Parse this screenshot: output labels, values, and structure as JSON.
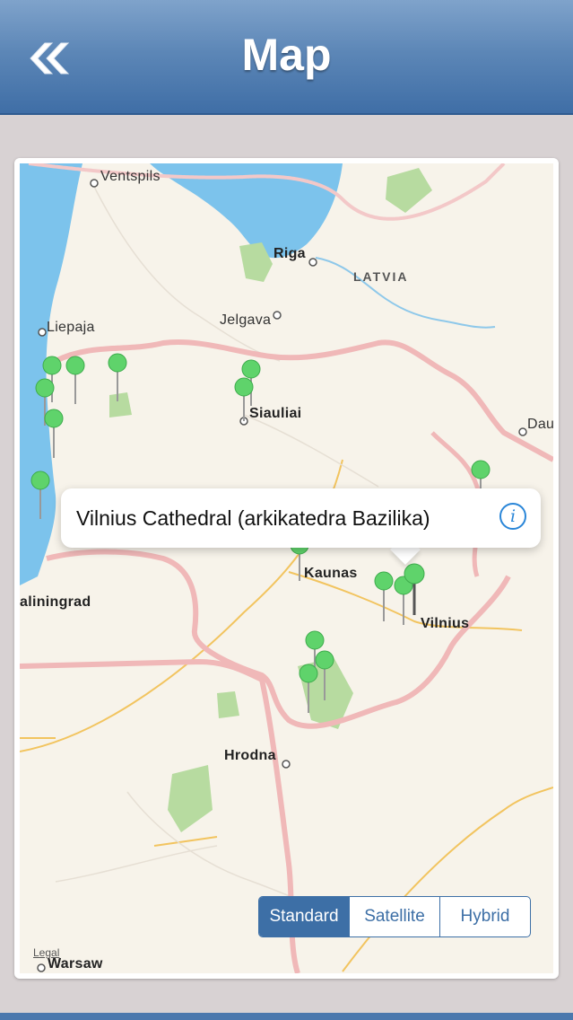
{
  "header": {
    "title": "Map",
    "back_icon": "double-chevron-left-icon"
  },
  "map": {
    "country_label": "LATVIA",
    "cities": [
      {
        "name": "Ventspils",
        "bold": false
      },
      {
        "name": "Riga",
        "bold": true
      },
      {
        "name": "Liepaja",
        "bold": false
      },
      {
        "name": "Jelgava",
        "bold": false
      },
      {
        "name": "Siauliai",
        "bold": true
      },
      {
        "name": "Dau",
        "bold": false
      },
      {
        "name": "Kaunas",
        "bold": true
      },
      {
        "name": "aliningrad",
        "bold": true
      },
      {
        "name": "Vilnius",
        "bold": true
      },
      {
        "name": "Hrodna",
        "bold": true
      },
      {
        "name": "Warsaw",
        "bold": true
      }
    ],
    "pin_color": "#5fd36b",
    "legal_text": "Legal"
  },
  "callout": {
    "title": "Vilnius Cathedral (arkikatedra Bazilika)",
    "info_icon": "info-icon",
    "info_glyph": "i"
  },
  "map_type": {
    "options": [
      "Standard",
      "Satellite",
      "Hybrid"
    ],
    "selected": "Standard"
  },
  "colors": {
    "header": "#5d87b7",
    "accent": "#3d6fa6",
    "water": "#7cc3ec",
    "border": "#f0b8b8"
  }
}
